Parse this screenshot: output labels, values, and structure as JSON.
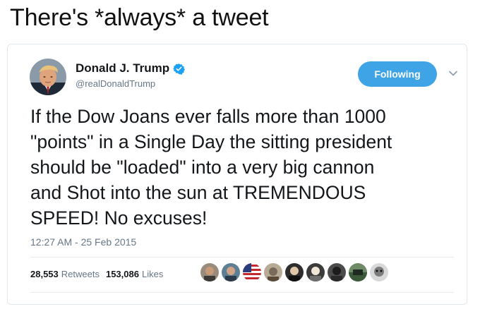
{
  "caption": "There's *always* a tweet",
  "tweet": {
    "display_name": "Donald J. Trump",
    "handle": "@realDonaldTrump",
    "follow_button_label": "Following",
    "text_lines": [
      "If the Dow Joans ever falls more than 1000",
      "\"points\" in a Single Day the sitting president",
      "should be \"loaded\" into a very big cannon",
      "and Shot into the sun at TREMENDOUS",
      "SPEED! No excuses!"
    ],
    "timestamp": "12:27 AM - 25 Feb 2015",
    "retweets_count": "28,553",
    "retweets_label": "Retweets",
    "likes_count": "153,086",
    "likes_label": "Likes"
  },
  "icons": {
    "verified": "verified-badge-icon",
    "chevron": "chevron-down-icon"
  },
  "colors": {
    "accent": "#1da1f2",
    "follow_button": "#3ea4e6",
    "secondary_text": "#657786",
    "primary_text": "#14171a",
    "border": "#e1e8ed"
  }
}
